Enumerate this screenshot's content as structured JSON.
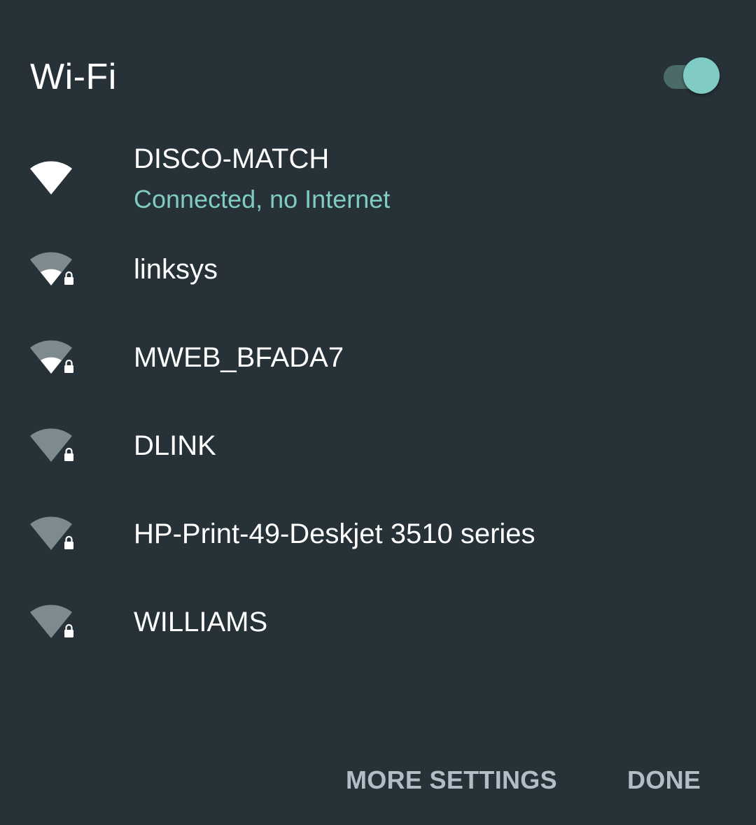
{
  "dialog": {
    "title": "Wi-Fi",
    "wifi_enabled": true,
    "colors": {
      "background": "#263238",
      "accent": "#80cbc4",
      "button_text": "#b0bec5"
    }
  },
  "networks": [
    {
      "ssid": "DISCO-MATCH",
      "status": "Connected, no Internet",
      "secured": false,
      "signal_bars": 4,
      "icon": "wifi-signal-full-icon"
    },
    {
      "ssid": "linksys",
      "secured": true,
      "signal_bars": 2,
      "icon": "wifi-signal-lock-icon"
    },
    {
      "ssid": "MWEB_BFADA7",
      "secured": true,
      "signal_bars": 2,
      "icon": "wifi-signal-lock-icon"
    },
    {
      "ssid": "DLINK",
      "secured": true,
      "signal_bars": 1,
      "icon": "wifi-signal-lock-icon"
    },
    {
      "ssid": "HP-Print-49-Deskjet 3510 series",
      "secured": true,
      "signal_bars": 1,
      "icon": "wifi-signal-lock-icon"
    },
    {
      "ssid": "WILLIAMS",
      "secured": true,
      "signal_bars": 1,
      "icon": "wifi-signal-lock-icon"
    }
  ],
  "actions": {
    "more_settings_label": "MORE SETTINGS",
    "done_label": "DONE"
  }
}
